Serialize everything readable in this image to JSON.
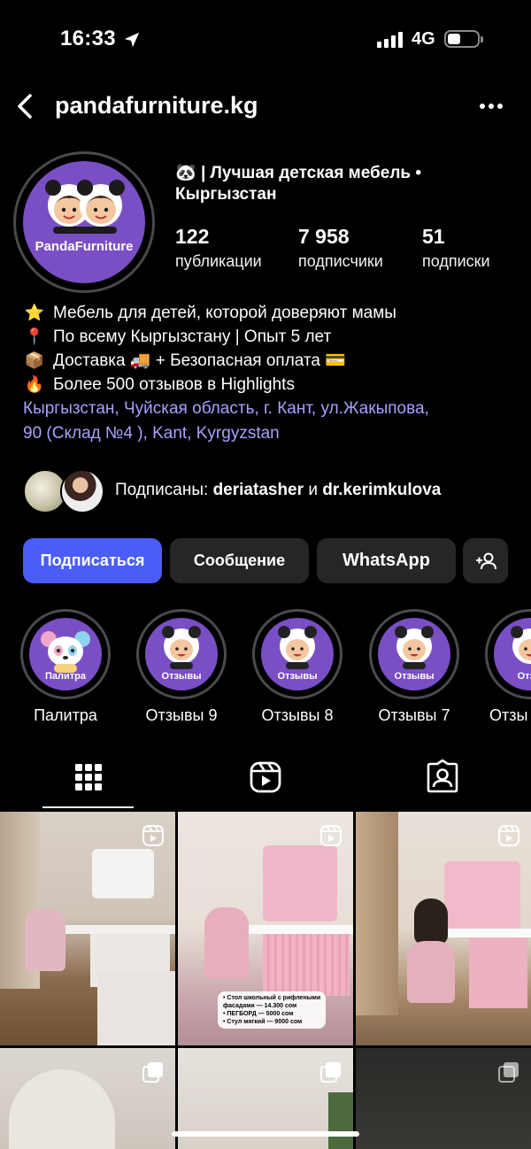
{
  "status_bar": {
    "time": "16:33",
    "network": "4G"
  },
  "header": {
    "username": "pandafurniture.kg"
  },
  "profile": {
    "avatar_brand": "PandaFurniture",
    "category_line1": "| Лучшая детская мебель •",
    "category_line2": "Кыргызстан",
    "stats": [
      {
        "value": "122",
        "label": "публикации"
      },
      {
        "value": "7 958",
        "label": "подписчики"
      },
      {
        "value": "51",
        "label": "подписки"
      }
    ],
    "bio": [
      {
        "icon": "star-emoji",
        "text": "Мебель для детей, которой доверяют мамы"
      },
      {
        "icon": "pin-emoji",
        "text": "По всему Кыргызстану | Опыт 5 лет"
      },
      {
        "icon": "package-emoji",
        "text": "Доставка 🚚 + Безопасная оплата 💳"
      },
      {
        "icon": "fire-emoji",
        "text": "Более 500 отзывов в Highlights"
      }
    ],
    "location_line1": "Кыргызстан, Чуйская область, г. Кант, ул.Жакыпова,",
    "location_line2": "90 (Склад №4 ), Kant, Kyrgyzstan",
    "followed_by": {
      "prefix": "Подписаны:",
      "user1": "deriatasher",
      "joiner": "и",
      "user2": "dr.kerimkulova"
    }
  },
  "actions": {
    "follow": "Подписаться",
    "message": "Сообщение",
    "whatsapp": "WhatsApp"
  },
  "highlights": [
    {
      "cover_caption": "Палитра",
      "title": "Палитра"
    },
    {
      "cover_caption": "Отзывы",
      "title": "Отзывы 9"
    },
    {
      "cover_caption": "Отзывы",
      "title": "Отзывы 8"
    },
    {
      "cover_caption": "Отзывы",
      "title": "Отзывы 7"
    },
    {
      "cover_caption": "Отзы",
      "title": "Отзы"
    }
  ],
  "post_caption": {
    "line1": "• Стол школьный с рифлеными",
    "line2": "фасадами — 14.300 сом",
    "line3": "• ПЕГБОРД — 5000 сом",
    "line4": "• Стул мягкий — 9000 сом"
  },
  "colors": {
    "accent": "#4a5df9",
    "link": "#a7a2ff",
    "brand_purple": "#7a4fc5",
    "button_bg": "#262626"
  }
}
